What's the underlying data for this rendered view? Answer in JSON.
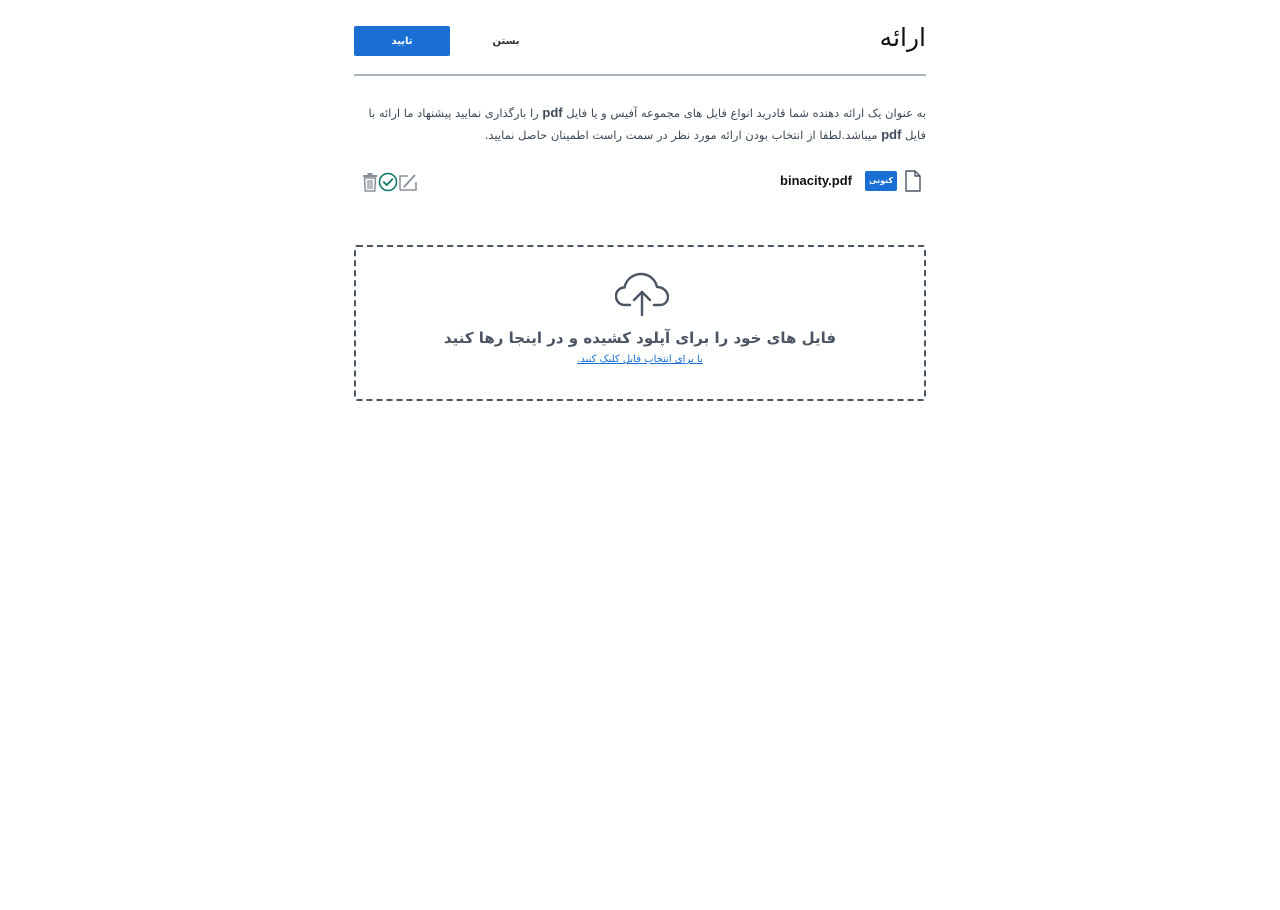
{
  "header": {
    "title": "ارائه",
    "confirm_label": "تایید",
    "close_label": "بستن"
  },
  "description": {
    "part1": "به عنوان یک ارائه دهنده شما قادرید انواع فایل های مجموعه آفیس و یا فایل ",
    "bold1": "pdf",
    "part2": " را بارگذاری نمایید پیشنهاد ما ارائه با فایل ",
    "bold2": "pdf",
    "part3": " میباشد.لطفا از انتخاب بودن ارائه مورد نظر در سمت راست اطمینان حاصل نمایید."
  },
  "file": {
    "name": "binacity.pdf",
    "badge": "کنونی",
    "icon": "file-icon",
    "actions": [
      "sign-icon",
      "check-circle-icon",
      "trash-icon"
    ]
  },
  "dropzone": {
    "title": "فایل های خود را برای آپلود کشیده و در اینجا رها کنید",
    "link": "یا برای انتخاب فایل کلیک کنید.",
    "icon": "cloud-upload-icon"
  },
  "colors": {
    "primary": "#1a6fd4",
    "check": "#0f766e",
    "icon_gray": "#8a9099",
    "border": "#4b5563"
  }
}
